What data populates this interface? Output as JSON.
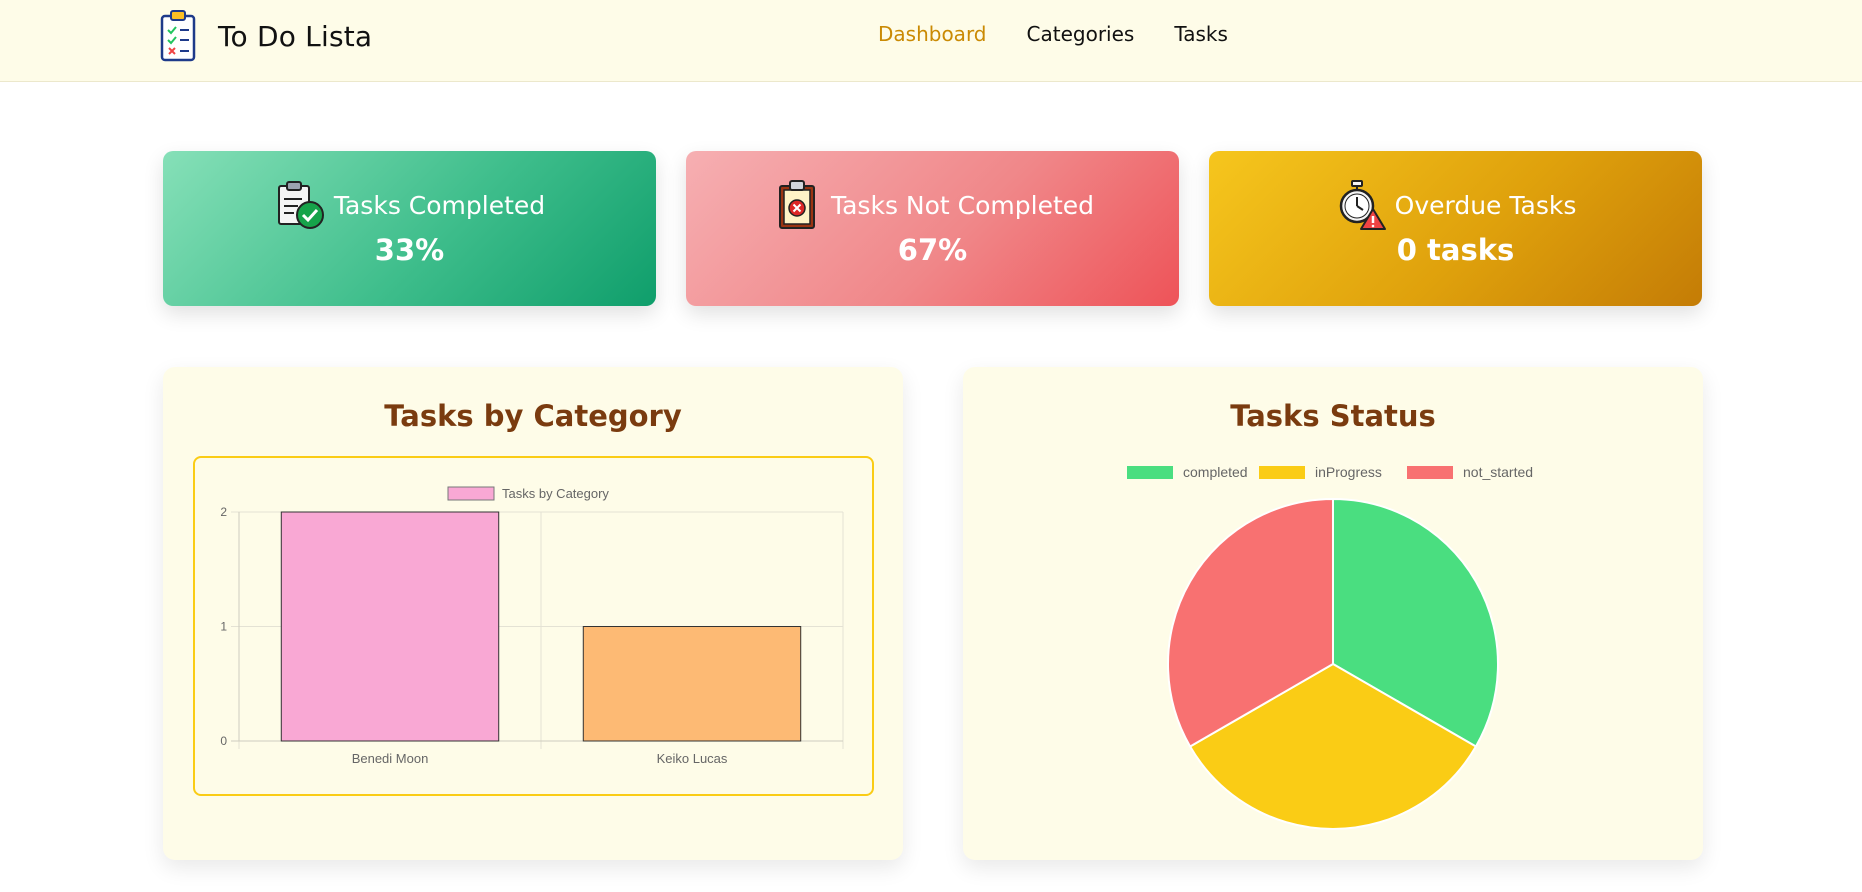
{
  "header": {
    "app_name": "To Do Lista",
    "logo_icon": "clipboard-checklist-icon",
    "nav": [
      {
        "label": "Dashboard",
        "active": true
      },
      {
        "label": "Categories",
        "active": false
      },
      {
        "label": "Tasks",
        "active": false
      }
    ],
    "active_color": "#ca8a04"
  },
  "stats": [
    {
      "title": "Tasks Completed",
      "value": "33%",
      "icon": "clipboard-check-icon",
      "color": "#10b981"
    },
    {
      "title": "Tasks Not Completed",
      "value": "67%",
      "icon": "clipboard-x-icon",
      "color": "#ef4444"
    },
    {
      "title": "Overdue Tasks",
      "value": "0 tasks",
      "icon": "stopwatch-warning-icon",
      "color": "#eab308"
    }
  ],
  "panels": {
    "category_title": "Tasks by Category",
    "status_title": "Tasks Status"
  },
  "chart_data": [
    {
      "type": "bar",
      "title": "",
      "legend": [
        "Tasks by Category"
      ],
      "legend_position": "top",
      "categories": [
        "Benedi Moon",
        "Keiko Lucas"
      ],
      "series": [
        {
          "name": "Tasks by Category",
          "values": [
            2,
            1
          ]
        }
      ],
      "colors": [
        "#f9a8d4",
        "#fdba74"
      ],
      "ylim": [
        0,
        2
      ],
      "yticks": [
        "0",
        "1",
        "2"
      ],
      "grid": true
    },
    {
      "type": "pie",
      "title": "",
      "legend_position": "top",
      "categories": [
        "completed",
        "inProgress",
        "not_started"
      ],
      "values": [
        1,
        1,
        1
      ],
      "colors": [
        "#4ade80",
        "#facc15",
        "#f87171"
      ]
    }
  ]
}
